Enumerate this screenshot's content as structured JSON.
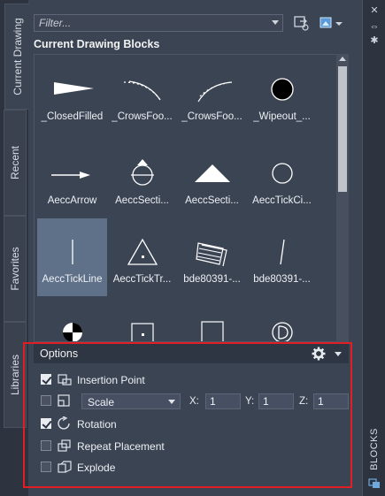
{
  "side_tabs": [
    "Current Drawing",
    "Recent",
    "Favorites",
    "Libraries"
  ],
  "right_strip": {
    "panel_label": "BLOCKS"
  },
  "filter": {
    "placeholder": "Filter..."
  },
  "section_title": "Current Drawing Blocks",
  "blocks": [
    {
      "label": "_ClosedFilled",
      "icon": "closed-filled-arrow"
    },
    {
      "label": "_CrowsFoo...",
      "icon": "crows-foot-arc-a"
    },
    {
      "label": "_CrowsFoo...",
      "icon": "crows-foot-arc-b"
    },
    {
      "label": "_Wipeout_...",
      "icon": "filled-circle"
    },
    {
      "label": "AeccArrow",
      "icon": "arrow"
    },
    {
      "label": "AeccSecti...",
      "icon": "section-circle"
    },
    {
      "label": "AeccSecti...",
      "icon": "section-triangle"
    },
    {
      "label": "AeccTickCi...",
      "icon": "tick-circle"
    },
    {
      "label": "AeccTickLine",
      "icon": "tick-line",
      "selected": true
    },
    {
      "label": "AeccTickTr...",
      "icon": "tick-triangle"
    },
    {
      "label": "bde80391-...",
      "icon": "stacked-sheets"
    },
    {
      "label": "bde80391-...",
      "icon": "slanted-line"
    },
    {
      "label": "",
      "icon": "quadrant-circle"
    },
    {
      "label": "",
      "icon": "dot-square"
    },
    {
      "label": "",
      "icon": "empty-square"
    },
    {
      "label": "",
      "icon": "d-circle"
    }
  ],
  "options": {
    "title": "Options",
    "insertion_point": {
      "label": "Insertion Point",
      "checked": true
    },
    "scale": {
      "checked": false,
      "mode": "Scale",
      "x_label": "X:",
      "x": "1",
      "y_label": "Y:",
      "y": "1",
      "z_label": "Z:",
      "z": "1"
    },
    "rotation": {
      "label": "Rotation",
      "checked": true
    },
    "repeat_placement": {
      "label": "Repeat Placement",
      "checked": false
    },
    "explode": {
      "label": "Explode",
      "checked": false
    }
  },
  "colors": {
    "accent_frame": "#e01e24",
    "selection": "#5f7089",
    "background": "#3b4453"
  }
}
